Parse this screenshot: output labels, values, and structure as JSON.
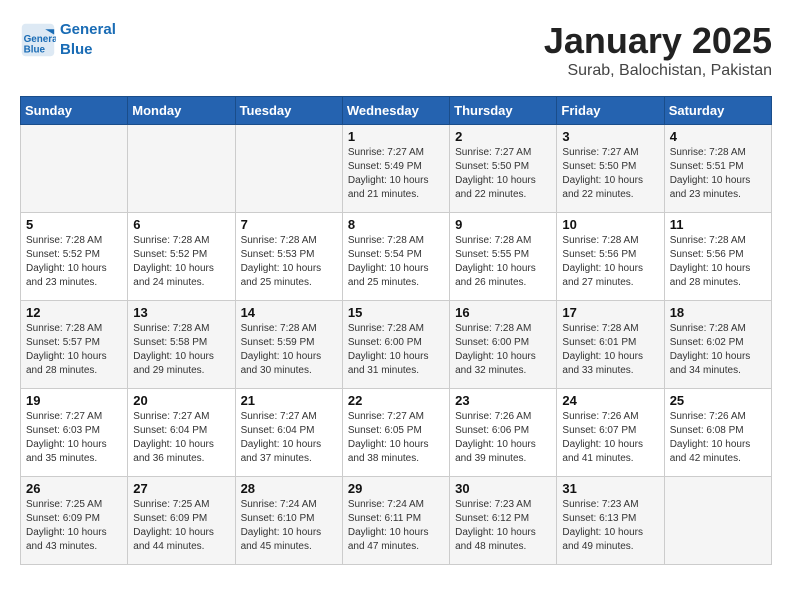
{
  "logo": {
    "line1": "General",
    "line2": "Blue"
  },
  "title": "January 2025",
  "subtitle": "Surab, Balochistan, Pakistan",
  "weekdays": [
    "Sunday",
    "Monday",
    "Tuesday",
    "Wednesday",
    "Thursday",
    "Friday",
    "Saturday"
  ],
  "weeks": [
    [
      {
        "day": "",
        "info": ""
      },
      {
        "day": "",
        "info": ""
      },
      {
        "day": "",
        "info": ""
      },
      {
        "day": "1",
        "sunrise": "7:27 AM",
        "sunset": "5:49 PM",
        "daylight": "10 hours and 21 minutes."
      },
      {
        "day": "2",
        "sunrise": "7:27 AM",
        "sunset": "5:50 PM",
        "daylight": "10 hours and 22 minutes."
      },
      {
        "day": "3",
        "sunrise": "7:27 AM",
        "sunset": "5:50 PM",
        "daylight": "10 hours and 22 minutes."
      },
      {
        "day": "4",
        "sunrise": "7:28 AM",
        "sunset": "5:51 PM",
        "daylight": "10 hours and 23 minutes."
      }
    ],
    [
      {
        "day": "5",
        "sunrise": "7:28 AM",
        "sunset": "5:52 PM",
        "daylight": "10 hours and 23 minutes."
      },
      {
        "day": "6",
        "sunrise": "7:28 AM",
        "sunset": "5:52 PM",
        "daylight": "10 hours and 24 minutes."
      },
      {
        "day": "7",
        "sunrise": "7:28 AM",
        "sunset": "5:53 PM",
        "daylight": "10 hours and 25 minutes."
      },
      {
        "day": "8",
        "sunrise": "7:28 AM",
        "sunset": "5:54 PM",
        "daylight": "10 hours and 25 minutes."
      },
      {
        "day": "9",
        "sunrise": "7:28 AM",
        "sunset": "5:55 PM",
        "daylight": "10 hours and 26 minutes."
      },
      {
        "day": "10",
        "sunrise": "7:28 AM",
        "sunset": "5:56 PM",
        "daylight": "10 hours and 27 minutes."
      },
      {
        "day": "11",
        "sunrise": "7:28 AM",
        "sunset": "5:56 PM",
        "daylight": "10 hours and 28 minutes."
      }
    ],
    [
      {
        "day": "12",
        "sunrise": "7:28 AM",
        "sunset": "5:57 PM",
        "daylight": "10 hours and 28 minutes."
      },
      {
        "day": "13",
        "sunrise": "7:28 AM",
        "sunset": "5:58 PM",
        "daylight": "10 hours and 29 minutes."
      },
      {
        "day": "14",
        "sunrise": "7:28 AM",
        "sunset": "5:59 PM",
        "daylight": "10 hours and 30 minutes."
      },
      {
        "day": "15",
        "sunrise": "7:28 AM",
        "sunset": "6:00 PM",
        "daylight": "10 hours and 31 minutes."
      },
      {
        "day": "16",
        "sunrise": "7:28 AM",
        "sunset": "6:00 PM",
        "daylight": "10 hours and 32 minutes."
      },
      {
        "day": "17",
        "sunrise": "7:28 AM",
        "sunset": "6:01 PM",
        "daylight": "10 hours and 33 minutes."
      },
      {
        "day": "18",
        "sunrise": "7:28 AM",
        "sunset": "6:02 PM",
        "daylight": "10 hours and 34 minutes."
      }
    ],
    [
      {
        "day": "19",
        "sunrise": "7:27 AM",
        "sunset": "6:03 PM",
        "daylight": "10 hours and 35 minutes."
      },
      {
        "day": "20",
        "sunrise": "7:27 AM",
        "sunset": "6:04 PM",
        "daylight": "10 hours and 36 minutes."
      },
      {
        "day": "21",
        "sunrise": "7:27 AM",
        "sunset": "6:04 PM",
        "daylight": "10 hours and 37 minutes."
      },
      {
        "day": "22",
        "sunrise": "7:27 AM",
        "sunset": "6:05 PM",
        "daylight": "10 hours and 38 minutes."
      },
      {
        "day": "23",
        "sunrise": "7:26 AM",
        "sunset": "6:06 PM",
        "daylight": "10 hours and 39 minutes."
      },
      {
        "day": "24",
        "sunrise": "7:26 AM",
        "sunset": "6:07 PM",
        "daylight": "10 hours and 41 minutes."
      },
      {
        "day": "25",
        "sunrise": "7:26 AM",
        "sunset": "6:08 PM",
        "daylight": "10 hours and 42 minutes."
      }
    ],
    [
      {
        "day": "26",
        "sunrise": "7:25 AM",
        "sunset": "6:09 PM",
        "daylight": "10 hours and 43 minutes."
      },
      {
        "day": "27",
        "sunrise": "7:25 AM",
        "sunset": "6:09 PM",
        "daylight": "10 hours and 44 minutes."
      },
      {
        "day": "28",
        "sunrise": "7:24 AM",
        "sunset": "6:10 PM",
        "daylight": "10 hours and 45 minutes."
      },
      {
        "day": "29",
        "sunrise": "7:24 AM",
        "sunset": "6:11 PM",
        "daylight": "10 hours and 47 minutes."
      },
      {
        "day": "30",
        "sunrise": "7:23 AM",
        "sunset": "6:12 PM",
        "daylight": "10 hours and 48 minutes."
      },
      {
        "day": "31",
        "sunrise": "7:23 AM",
        "sunset": "6:13 PM",
        "daylight": "10 hours and 49 minutes."
      },
      {
        "day": "",
        "info": ""
      }
    ]
  ]
}
